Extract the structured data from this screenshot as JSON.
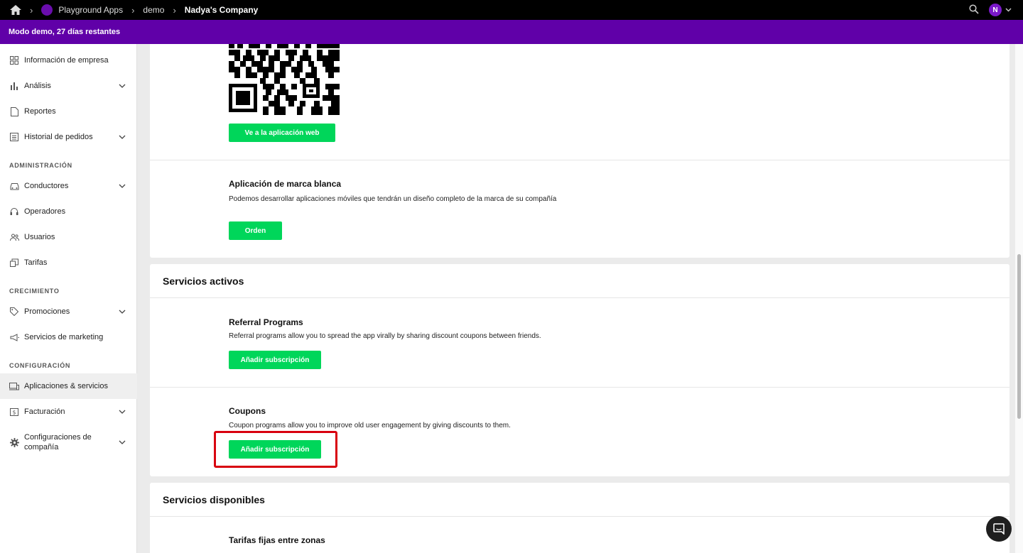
{
  "topbar": {
    "crumbs": [
      "Playground Apps",
      "demo",
      "Nadya's Company"
    ],
    "avatar_initial": "N"
  },
  "banner": {
    "text": "Modo demo, 27 días restantes"
  },
  "sidebar": {
    "items": [
      {
        "label": "Información de empresa",
        "icon": "grid-icon"
      },
      {
        "label": "Análisis",
        "icon": "bar-chart-icon"
      },
      {
        "label": "Reportes",
        "icon": "document-icon"
      },
      {
        "label": "Historial de pedidos",
        "icon": "list-icon"
      },
      {
        "label": "Conductores",
        "icon": "car-icon"
      },
      {
        "label": "Operadores",
        "icon": "headset-icon"
      },
      {
        "label": "Usuarios",
        "icon": "users-icon"
      },
      {
        "label": "Tarifas",
        "icon": "tariff-icon"
      },
      {
        "label": "Promociones",
        "icon": "tag-icon"
      },
      {
        "label": "Servicios de marketing",
        "icon": "megaphone-icon"
      },
      {
        "label": "Aplicaciones & servicios",
        "icon": "devices-icon"
      },
      {
        "label": "Facturación",
        "icon": "billing-icon"
      },
      {
        "label": "Configuraciones de compañía",
        "icon": "gear-icon"
      }
    ],
    "sections": [
      "ADMINISTRACIÓN",
      "CRECIMIENTO",
      "CONFIGURACIÓN"
    ]
  },
  "main": {
    "webapp_button": "Ve a la aplicación web",
    "white_label": {
      "title": "Aplicación de marca blanca",
      "desc": "Podemos desarrollar aplicaciones móviles que tendrán un diseño completo de la marca de su compañía",
      "button": "Orden"
    },
    "active_services": {
      "header": "Servicios activos",
      "items": [
        {
          "title": "Referral Programs",
          "desc": "Referral programs allow you to spread the app virally by sharing discount coupons between friends.",
          "button": "Añadir subscripción"
        },
        {
          "title": "Coupons",
          "desc": "Coupon programs allow you to improve old user engagement by giving discounts to them.",
          "button": "Añadir subscripción"
        }
      ]
    },
    "available_services": {
      "header": "Servicios disponibles",
      "first_item_title": "Tarifas fijas entre zonas"
    }
  },
  "colors": {
    "accent": "#6000a8",
    "button": "#00d65a",
    "highlight": "#d8000f"
  }
}
